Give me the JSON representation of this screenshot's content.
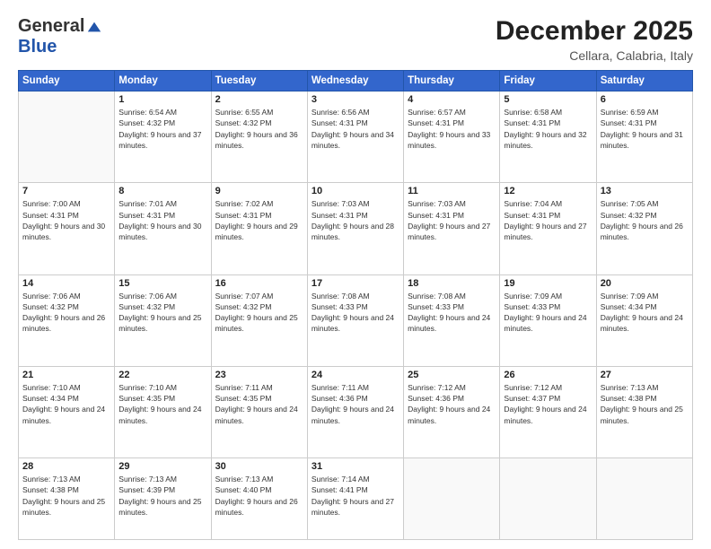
{
  "logo": {
    "general": "General",
    "blue": "Blue"
  },
  "header": {
    "month": "December 2025",
    "location": "Cellara, Calabria, Italy"
  },
  "weekdays": [
    "Sunday",
    "Monday",
    "Tuesday",
    "Wednesday",
    "Thursday",
    "Friday",
    "Saturday"
  ],
  "weeks": [
    [
      {
        "day": "",
        "sunrise": "",
        "sunset": "",
        "daylight": ""
      },
      {
        "day": "1",
        "sunrise": "Sunrise: 6:54 AM",
        "sunset": "Sunset: 4:32 PM",
        "daylight": "Daylight: 9 hours and 37 minutes."
      },
      {
        "day": "2",
        "sunrise": "Sunrise: 6:55 AM",
        "sunset": "Sunset: 4:32 PM",
        "daylight": "Daylight: 9 hours and 36 minutes."
      },
      {
        "day": "3",
        "sunrise": "Sunrise: 6:56 AM",
        "sunset": "Sunset: 4:31 PM",
        "daylight": "Daylight: 9 hours and 34 minutes."
      },
      {
        "day": "4",
        "sunrise": "Sunrise: 6:57 AM",
        "sunset": "Sunset: 4:31 PM",
        "daylight": "Daylight: 9 hours and 33 minutes."
      },
      {
        "day": "5",
        "sunrise": "Sunrise: 6:58 AM",
        "sunset": "Sunset: 4:31 PM",
        "daylight": "Daylight: 9 hours and 32 minutes."
      },
      {
        "day": "6",
        "sunrise": "Sunrise: 6:59 AM",
        "sunset": "Sunset: 4:31 PM",
        "daylight": "Daylight: 9 hours and 31 minutes."
      }
    ],
    [
      {
        "day": "7",
        "sunrise": "Sunrise: 7:00 AM",
        "sunset": "Sunset: 4:31 PM",
        "daylight": "Daylight: 9 hours and 30 minutes."
      },
      {
        "day": "8",
        "sunrise": "Sunrise: 7:01 AM",
        "sunset": "Sunset: 4:31 PM",
        "daylight": "Daylight: 9 hours and 30 minutes."
      },
      {
        "day": "9",
        "sunrise": "Sunrise: 7:02 AM",
        "sunset": "Sunset: 4:31 PM",
        "daylight": "Daylight: 9 hours and 29 minutes."
      },
      {
        "day": "10",
        "sunrise": "Sunrise: 7:03 AM",
        "sunset": "Sunset: 4:31 PM",
        "daylight": "Daylight: 9 hours and 28 minutes."
      },
      {
        "day": "11",
        "sunrise": "Sunrise: 7:03 AM",
        "sunset": "Sunset: 4:31 PM",
        "daylight": "Daylight: 9 hours and 27 minutes."
      },
      {
        "day": "12",
        "sunrise": "Sunrise: 7:04 AM",
        "sunset": "Sunset: 4:31 PM",
        "daylight": "Daylight: 9 hours and 27 minutes."
      },
      {
        "day": "13",
        "sunrise": "Sunrise: 7:05 AM",
        "sunset": "Sunset: 4:32 PM",
        "daylight": "Daylight: 9 hours and 26 minutes."
      }
    ],
    [
      {
        "day": "14",
        "sunrise": "Sunrise: 7:06 AM",
        "sunset": "Sunset: 4:32 PM",
        "daylight": "Daylight: 9 hours and 26 minutes."
      },
      {
        "day": "15",
        "sunrise": "Sunrise: 7:06 AM",
        "sunset": "Sunset: 4:32 PM",
        "daylight": "Daylight: 9 hours and 25 minutes."
      },
      {
        "day": "16",
        "sunrise": "Sunrise: 7:07 AM",
        "sunset": "Sunset: 4:32 PM",
        "daylight": "Daylight: 9 hours and 25 minutes."
      },
      {
        "day": "17",
        "sunrise": "Sunrise: 7:08 AM",
        "sunset": "Sunset: 4:33 PM",
        "daylight": "Daylight: 9 hours and 24 minutes."
      },
      {
        "day": "18",
        "sunrise": "Sunrise: 7:08 AM",
        "sunset": "Sunset: 4:33 PM",
        "daylight": "Daylight: 9 hours and 24 minutes."
      },
      {
        "day": "19",
        "sunrise": "Sunrise: 7:09 AM",
        "sunset": "Sunset: 4:33 PM",
        "daylight": "Daylight: 9 hours and 24 minutes."
      },
      {
        "day": "20",
        "sunrise": "Sunrise: 7:09 AM",
        "sunset": "Sunset: 4:34 PM",
        "daylight": "Daylight: 9 hours and 24 minutes."
      }
    ],
    [
      {
        "day": "21",
        "sunrise": "Sunrise: 7:10 AM",
        "sunset": "Sunset: 4:34 PM",
        "daylight": "Daylight: 9 hours and 24 minutes."
      },
      {
        "day": "22",
        "sunrise": "Sunrise: 7:10 AM",
        "sunset": "Sunset: 4:35 PM",
        "daylight": "Daylight: 9 hours and 24 minutes."
      },
      {
        "day": "23",
        "sunrise": "Sunrise: 7:11 AM",
        "sunset": "Sunset: 4:35 PM",
        "daylight": "Daylight: 9 hours and 24 minutes."
      },
      {
        "day": "24",
        "sunrise": "Sunrise: 7:11 AM",
        "sunset": "Sunset: 4:36 PM",
        "daylight": "Daylight: 9 hours and 24 minutes."
      },
      {
        "day": "25",
        "sunrise": "Sunrise: 7:12 AM",
        "sunset": "Sunset: 4:36 PM",
        "daylight": "Daylight: 9 hours and 24 minutes."
      },
      {
        "day": "26",
        "sunrise": "Sunrise: 7:12 AM",
        "sunset": "Sunset: 4:37 PM",
        "daylight": "Daylight: 9 hours and 24 minutes."
      },
      {
        "day": "27",
        "sunrise": "Sunrise: 7:13 AM",
        "sunset": "Sunset: 4:38 PM",
        "daylight": "Daylight: 9 hours and 25 minutes."
      }
    ],
    [
      {
        "day": "28",
        "sunrise": "Sunrise: 7:13 AM",
        "sunset": "Sunset: 4:38 PM",
        "daylight": "Daylight: 9 hours and 25 minutes."
      },
      {
        "day": "29",
        "sunrise": "Sunrise: 7:13 AM",
        "sunset": "Sunset: 4:39 PM",
        "daylight": "Daylight: 9 hours and 25 minutes."
      },
      {
        "day": "30",
        "sunrise": "Sunrise: 7:13 AM",
        "sunset": "Sunset: 4:40 PM",
        "daylight": "Daylight: 9 hours and 26 minutes."
      },
      {
        "day": "31",
        "sunrise": "Sunrise: 7:14 AM",
        "sunset": "Sunset: 4:41 PM",
        "daylight": "Daylight: 9 hours and 27 minutes."
      },
      {
        "day": "",
        "sunrise": "",
        "sunset": "",
        "daylight": ""
      },
      {
        "day": "",
        "sunrise": "",
        "sunset": "",
        "daylight": ""
      },
      {
        "day": "",
        "sunrise": "",
        "sunset": "",
        "daylight": ""
      }
    ]
  ]
}
